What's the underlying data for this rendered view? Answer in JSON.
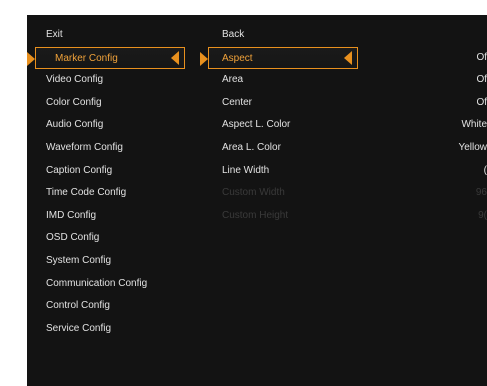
{
  "menu": {
    "main": [
      {
        "label": "Exit"
      },
      {
        "label": "Marker Config"
      },
      {
        "label": "Video Config"
      },
      {
        "label": "Color Config"
      },
      {
        "label": "Audio Config"
      },
      {
        "label": "Waveform Config"
      },
      {
        "label": "Caption Config"
      },
      {
        "label": "Time Code Config"
      },
      {
        "label": "IMD Config"
      },
      {
        "label": "OSD Config"
      },
      {
        "label": "System Config"
      },
      {
        "label": "Communication Config"
      },
      {
        "label": "Control Config"
      },
      {
        "label": "Service Config"
      }
    ],
    "sub": [
      {
        "label": "Back"
      },
      {
        "label": "Aspect"
      },
      {
        "label": "Area"
      },
      {
        "label": "Center"
      },
      {
        "label": "Aspect L. Color"
      },
      {
        "label": "Area L. Color"
      },
      {
        "label": "Line Width"
      },
      {
        "label": "Custom Width"
      },
      {
        "label": "Custom Height"
      }
    ],
    "values": [
      {
        "label": ""
      },
      {
        "label": "Of"
      },
      {
        "label": "Of"
      },
      {
        "label": "Of"
      },
      {
        "label": "White"
      },
      {
        "label": "Yellow"
      },
      {
        "label": "("
      },
      {
        "label": "96"
      },
      {
        "label": "9("
      }
    ]
  },
  "colors": {
    "accent": "#e8901e",
    "background": "#131313",
    "text": "#e2e2e2"
  }
}
